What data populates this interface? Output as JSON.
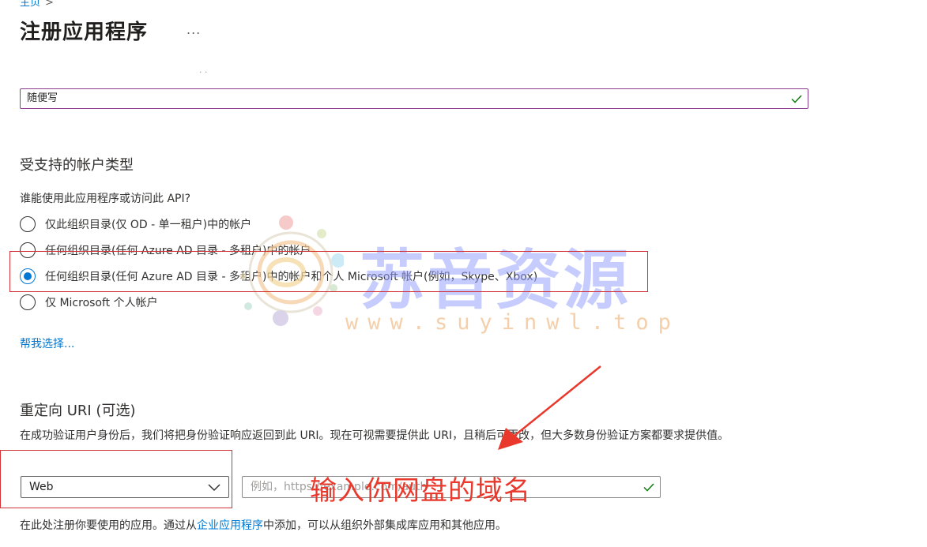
{
  "breadcrumb": {
    "home": "主页",
    "separator": ">"
  },
  "page": {
    "title": "注册应用程序",
    "more": "..."
  },
  "name_field": {
    "faded_label": ". .",
    "value": "随便写"
  },
  "account_types": {
    "heading": "受支持的帐户类型",
    "question": "谁能使用此应用程序或访问此 API?",
    "options": [
      {
        "label": "仅此组织目录(仅 OD - 单一租户)中的帐户",
        "checked": false
      },
      {
        "label": "任何组织目录(任何 Azure AD 目录 - 多租户)中的帐户",
        "checked": false
      },
      {
        "label": "任何组织目录(任何 Azure AD 目录 - 多租户)中的帐户和个人 Microsoft 帐户(例如，Skype、Xbox)",
        "checked": true
      },
      {
        "label": "仅 Microsoft 个人帐户",
        "checked": false
      }
    ],
    "help_link": "帮我选择..."
  },
  "redirect": {
    "heading": "重定向 URI (可选)",
    "description": "在成功验证用户身份后，我们将把身份验证响应返回到此 URI。现在可视需要提供此 URI，且稍后可更改，但大多数身份验证方案都要求提供值。",
    "platform_selected": "Web",
    "uri_placeholder": "例如，https://example.com/auth"
  },
  "footer": {
    "text_before": "在此处注册你要使用的应用。通过从",
    "link": "企业应用程序",
    "text_after": "中添加，可以从组织外部集成库应用和其他应用。"
  },
  "watermark": {
    "main": "苏音资源",
    "url": "www.suyinwl.top"
  },
  "annotation": {
    "text": "输入你网盘的域名"
  },
  "colors": {
    "accent": "#0078d4",
    "annotation_red": "#e8392c",
    "input_focus": "#8a3b8f",
    "success_check": "#107c10"
  }
}
